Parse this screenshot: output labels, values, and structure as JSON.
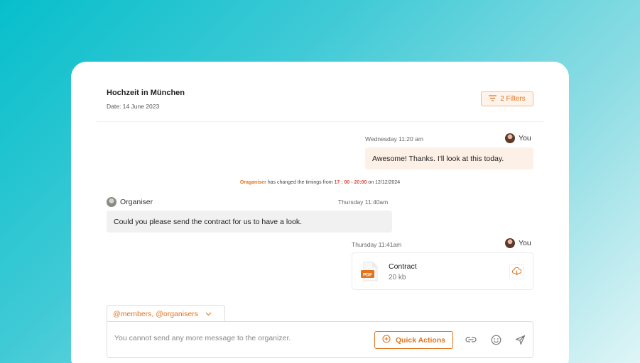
{
  "conversation": {
    "title": "Hochzeit in München",
    "date": "Date: 14 June 2023",
    "filters_label": "2 Filters"
  },
  "messages": [
    {
      "sender": "You",
      "time": "Wednesday 11:20 am",
      "text": "Awesome! Thanks. I'll look at this today."
    },
    {
      "sender": "Organiser",
      "time": "Thursday 11:40am",
      "text": "Could you please send the contract for us to have a look."
    },
    {
      "sender": "You",
      "time": "Thursday 11:41am",
      "file": {
        "name": "Contract",
        "size": "20 kb",
        "type": "PDF"
      }
    }
  ],
  "system_notice": {
    "actor": "Oraganiser",
    "text_before": " has changed the timings from ",
    "time_range": "17 : 00 - 20:00",
    "text_after": " on 12/12/2024"
  },
  "composer": {
    "mention_label": "@members, @organisers",
    "placeholder": "You cannot send any more message to the organizer.",
    "quick_actions_label": "Quick Actions"
  },
  "colors": {
    "accent": "#e0741f",
    "outgoing_bubble": "#fdf0e6",
    "incoming_bubble": "#f1f1f1"
  },
  "icons": [
    "filter-icon",
    "pdf-file-icon",
    "download-cloud-icon",
    "chevron-down-icon",
    "plus-circle-icon",
    "link-icon",
    "emoji-icon",
    "send-icon"
  ]
}
